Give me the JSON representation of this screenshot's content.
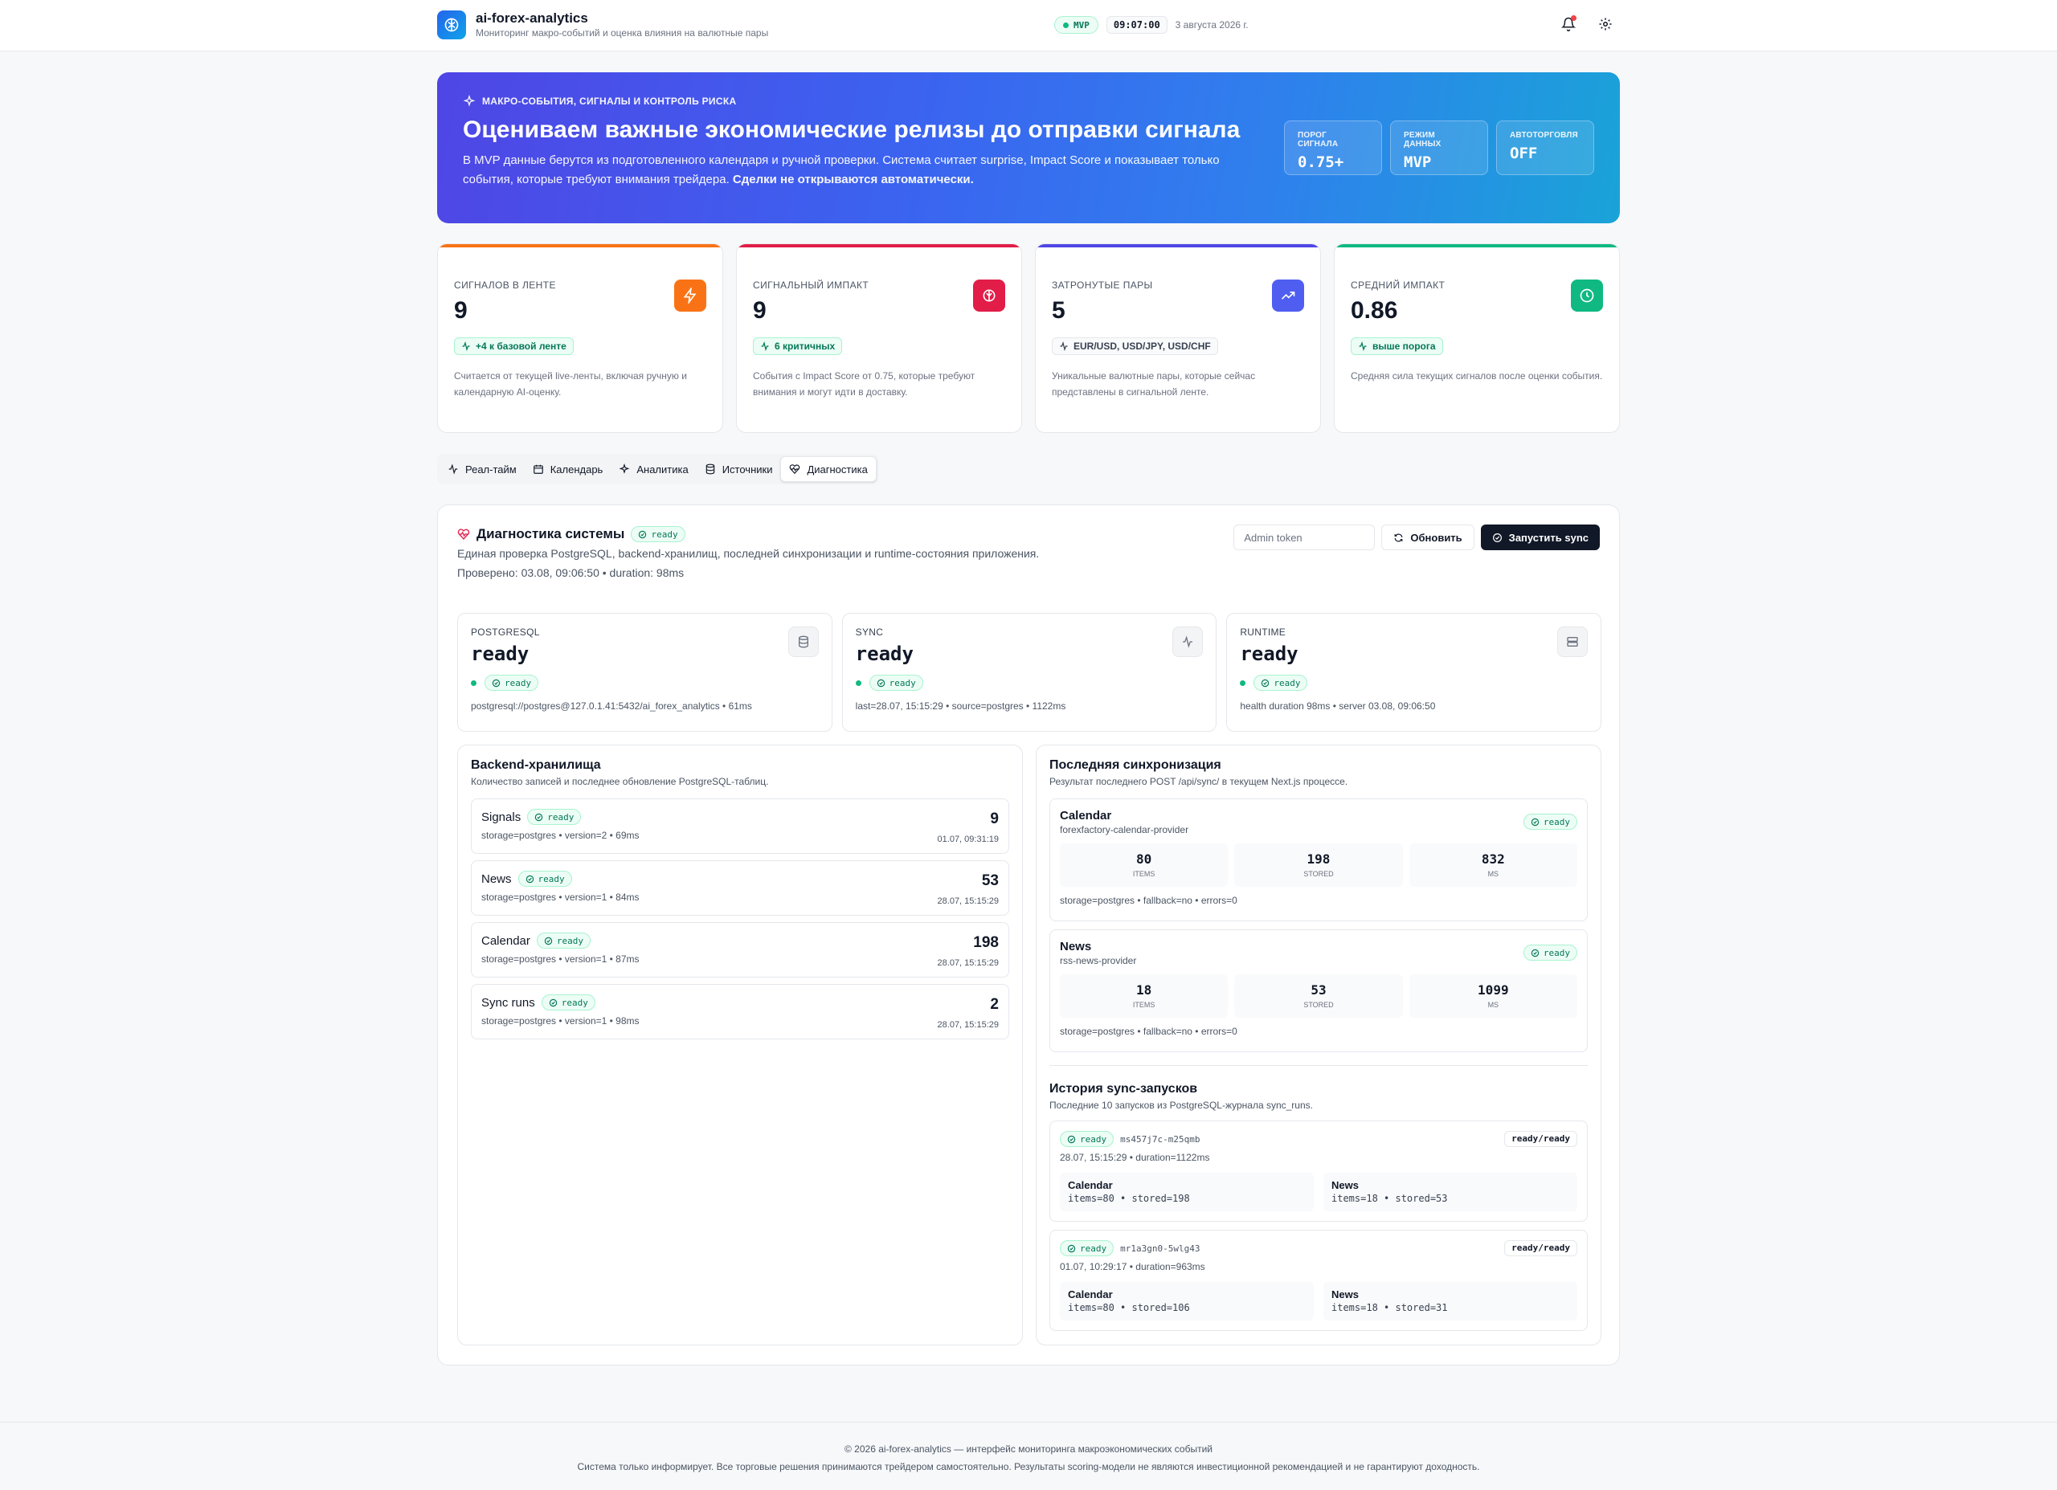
{
  "header": {
    "app_title": "ai-forex-analytics",
    "app_subtitle": "Мониторинг макро-событий и оценка влияния на валютные пары",
    "mode_badge": "MVP",
    "clock": "09:07:00",
    "date": "3 августа 2026 г."
  },
  "hero": {
    "kicker": "МАКРО-СОБЫТИЯ, СИГНАЛЫ И КОНТРОЛЬ РИСКА",
    "title": "Оцениваем важные экономические релизы до отправки сигнала",
    "desc_main": "В MVP данные берутся из подготовленного календаря и ручной проверки. Система считает surprise, Impact Score и показывает только события, которые требуют внимания трейдера.",
    "desc_bold": "Сделки не открываются автоматически.",
    "stats": [
      {
        "label": "ПОРОГ СИГНАЛА",
        "value": "0.75+"
      },
      {
        "label": "РЕЖИМ ДАННЫХ",
        "value": "MVP"
      },
      {
        "label": "АВТОТОРГОВЛЯ",
        "value": "OFF"
      }
    ]
  },
  "kpis": [
    {
      "label": "Сигналов в ленте",
      "value": "9",
      "badge": "+4 к базовой ленте",
      "desc": "Считается от текущей live-ленты, включая ручную и календарную AI-оценку."
    },
    {
      "label": "Сигнальный импакт",
      "value": "9",
      "badge": "6 критичных",
      "desc": "События с Impact Score от 0.75, которые требуют внимания и могут идти в доставку."
    },
    {
      "label": "Затронутые пары",
      "value": "5",
      "badge": "EUR/USD, USD/JPY, USD/CHF",
      "desc": "Уникальные валютные пары, которые сейчас представлены в сигнальной ленте."
    },
    {
      "label": "Средний импакт",
      "value": "0.86",
      "badge": "выше порога",
      "desc": "Средняя сила текущих сигналов после оценки события."
    }
  ],
  "colors": {
    "orange": "#f97316",
    "red": "#e11d48",
    "blue": "#4f46e5",
    "green": "#10b981"
  },
  "tabs": [
    "Реал-тайм",
    "Календарь",
    "Аналитика",
    "Источники",
    "Диагностика"
  ],
  "diagnostics": {
    "title": "Диагностика системы",
    "status": "ready",
    "subtitle": "Единая проверка PostgreSQL, backend-хранилищ, последней синхронизации и runtime-состояния приложения.",
    "checked": "Проверено: 03.08, 09:06:50 • duration: 98ms",
    "admin_placeholder": "Admin token",
    "refresh_label": "Обновить",
    "run_sync_label": "Запустить sync"
  },
  "services": [
    {
      "label": "PostgreSQL",
      "value": "ready",
      "status": "ready",
      "meta": "postgresql://postgres@127.0.1.41:5432/ai_forex_analytics • 61ms",
      "icon": "database-icon"
    },
    {
      "label": "Sync",
      "value": "ready",
      "status": "ready",
      "meta": "last=28.07, 15:15:29 • source=postgres • 1122ms",
      "icon": "activity-icon"
    },
    {
      "label": "Runtime",
      "value": "ready",
      "status": "ready",
      "meta": "health duration 98ms • server 03.08, 09:06:50",
      "icon": "server-icon"
    }
  ],
  "storage": {
    "title": "Backend-хранилища",
    "subtitle": "Количество записей и последнее обновление PostgreSQL-таблиц.",
    "items": [
      {
        "name": "Signals",
        "status": "ready",
        "meta": "storage=postgres • version=2 • 69ms",
        "count": "9",
        "date": "01.07, 09:31:19"
      },
      {
        "name": "News",
        "status": "ready",
        "meta": "storage=postgres • version=1 • 84ms",
        "count": "53",
        "date": "28.07, 15:15:29"
      },
      {
        "name": "Calendar",
        "status": "ready",
        "meta": "storage=postgres • version=1 • 87ms",
        "count": "198",
        "date": "28.07, 15:15:29"
      },
      {
        "name": "Sync runs",
        "status": "ready",
        "meta": "storage=postgres • version=1 • 98ms",
        "count": "2",
        "date": "28.07, 15:15:29"
      }
    ]
  },
  "last_sync": {
    "title": "Последняя синхронизация",
    "subtitle": "Результат последнего POST /api/sync/ в текущем Next.js процессе.",
    "items": [
      {
        "name": "Calendar",
        "provider": "forexfactory-calendar-provider",
        "status": "ready",
        "metrics": [
          {
            "value": "80",
            "label": "ITEMS"
          },
          {
            "value": "198",
            "label": "STORED"
          },
          {
            "value": "832",
            "label": "MS"
          }
        ],
        "foot": "storage=postgres • fallback=no • errors=0"
      },
      {
        "name": "News",
        "provider": "rss-news-provider",
        "status": "ready",
        "metrics": [
          {
            "value": "18",
            "label": "ITEMS"
          },
          {
            "value": "53",
            "label": "STORED"
          },
          {
            "value": "1099",
            "label": "MS"
          }
        ],
        "foot": "storage=postgres • fallback=no • errors=0"
      }
    ]
  },
  "history": {
    "title": "История sync-запусков",
    "subtitle": "Последние 10 запусков из PostgreSQL-журнала sync_runs.",
    "runs": [
      {
        "status": "ready",
        "id": "ms457j7c-m25qmb",
        "tag": "ready/ready",
        "meta": "28.07, 15:15:29 • duration=1122ms",
        "cells": [
          {
            "name": "Calendar",
            "value": "items=80 • stored=198"
          },
          {
            "name": "News",
            "value": "items=18 • stored=53"
          }
        ]
      },
      {
        "status": "ready",
        "id": "mr1a3gn0-5wlg43",
        "tag": "ready/ready",
        "meta": "01.07, 10:29:17 • duration=963ms",
        "cells": [
          {
            "name": "Calendar",
            "value": "items=80 • stored=106"
          },
          {
            "name": "News",
            "value": "items=18 • stored=31"
          }
        ]
      }
    ]
  },
  "footer": {
    "line1": "© 2026 ai-forex-analytics — интерфейс мониторинга макроэкономических событий",
    "line2": "Система только информирует. Все торговые решения принимаются трейдером самостоятельно. Результаты scoring-модели не являются инвестиционной рекомендацией и не гарантируют доходность."
  }
}
